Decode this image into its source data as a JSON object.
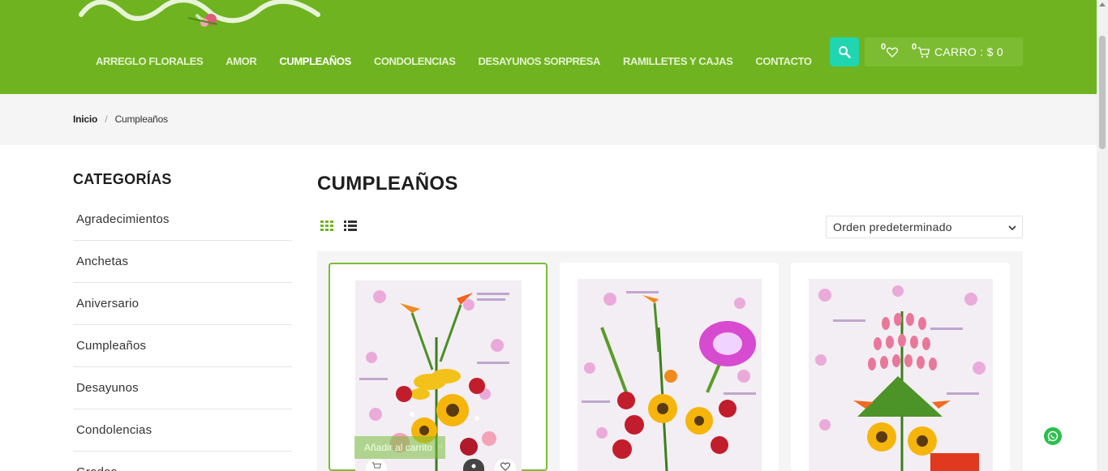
{
  "header": {
    "nav": [
      {
        "label": "ARREGLO FLORALES"
      },
      {
        "label": "AMOR"
      },
      {
        "label": "CUMPLEAÑOS"
      },
      {
        "label": "CONDOLENCIAS"
      },
      {
        "label": "DESAYUNOS SORPRESA"
      },
      {
        "label": "RAMILLETES Y CAJAS"
      },
      {
        "label": "CONTACTO"
      }
    ],
    "active_nav": "CUMPLEAÑOS",
    "wishlist_count": "0",
    "cart_count": "0",
    "cart_label": "CARRO : $ 0",
    "colors": {
      "header_bg": "#6fb320",
      "search_btn": "#1fd6b0"
    }
  },
  "breadcrumb": {
    "home": "Inicio",
    "separator": "/",
    "current": "Cumpleaños"
  },
  "sidebar": {
    "title": "CATEGORÍAS",
    "items": [
      {
        "label": "Agradecimientos"
      },
      {
        "label": "Anchetas"
      },
      {
        "label": "Aniversario"
      },
      {
        "label": "Cumpleaños"
      },
      {
        "label": "Desayunos"
      },
      {
        "label": "Condolencias"
      },
      {
        "label": "Grados"
      }
    ]
  },
  "main": {
    "title": "CUMPLEAÑOS",
    "sort_selected": "Orden predeterminado",
    "products": [
      {
        "overlay": "Añadir al carrito",
        "image": "flower-arrangement-lilies-sunflowers"
      },
      {
        "image": "flower-arrangement-roses-balloon"
      },
      {
        "image": "flower-arrangement-pink-roses-sunflowers"
      }
    ]
  },
  "icons": [
    "logo",
    "search-icon",
    "heart-icon",
    "cart-icon",
    "grid-view-icon",
    "list-view-icon",
    "chevron-down-icon",
    "whatsapp-icon"
  ]
}
